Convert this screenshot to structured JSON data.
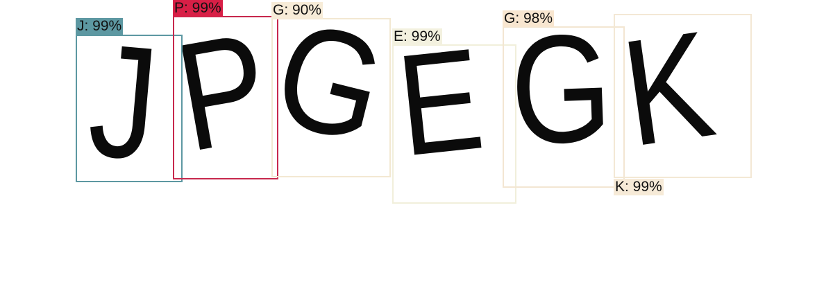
{
  "image": {
    "content": "JPGEGK"
  },
  "detections": [
    {
      "text": "J: 99%",
      "character": "J",
      "confidence": "99%",
      "color": "#5d98a2",
      "label_bg": "#5d98a2"
    },
    {
      "text": "P: 99%",
      "character": "P",
      "confidence": "99%",
      "color": "#c7284d",
      "label_bg": "#d81f46"
    },
    {
      "text": "G: 90%",
      "character": "G",
      "confidence": "90%",
      "color": "#f3e8d2",
      "label_bg": "#f7ecd8"
    },
    {
      "text": "E: 99%",
      "character": "E",
      "confidence": "99%",
      "color": "#f1efdb",
      "label_bg": "#f3f1df"
    },
    {
      "text": "G: 98%",
      "character": "G",
      "confidence": "98%",
      "color": "#f3e6d2",
      "label_bg": "#f8e6d0"
    },
    {
      "text": "K: 99%",
      "character": "K",
      "confidence": "99%",
      "color": "#f3e8d5",
      "label_bg": "#f6ead7"
    }
  ]
}
